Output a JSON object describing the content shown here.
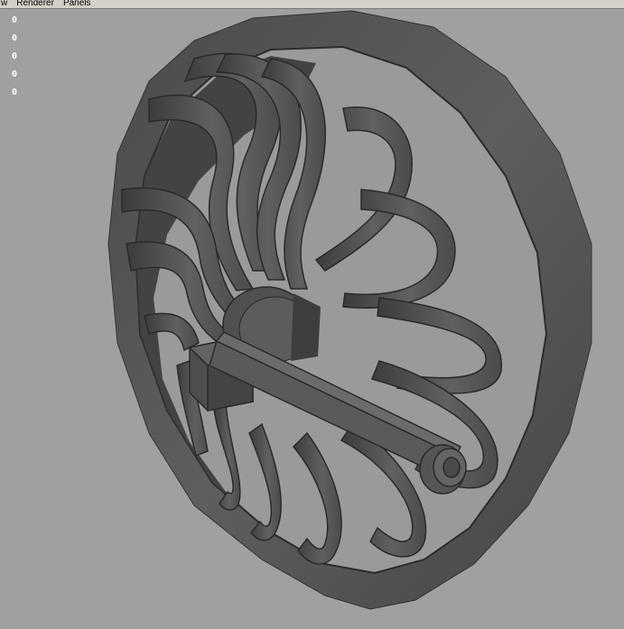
{
  "menu": {
    "items": [
      "w",
      "Renderer",
      "Panels"
    ]
  },
  "hud": {
    "values": [
      "0",
      "0",
      "0",
      "0",
      "0"
    ]
  },
  "viewport": {
    "background": "#a0a0a0",
    "model_color": "#555555",
    "model_dark": "#2a2a2a",
    "model_light": "#6a6a6a"
  }
}
